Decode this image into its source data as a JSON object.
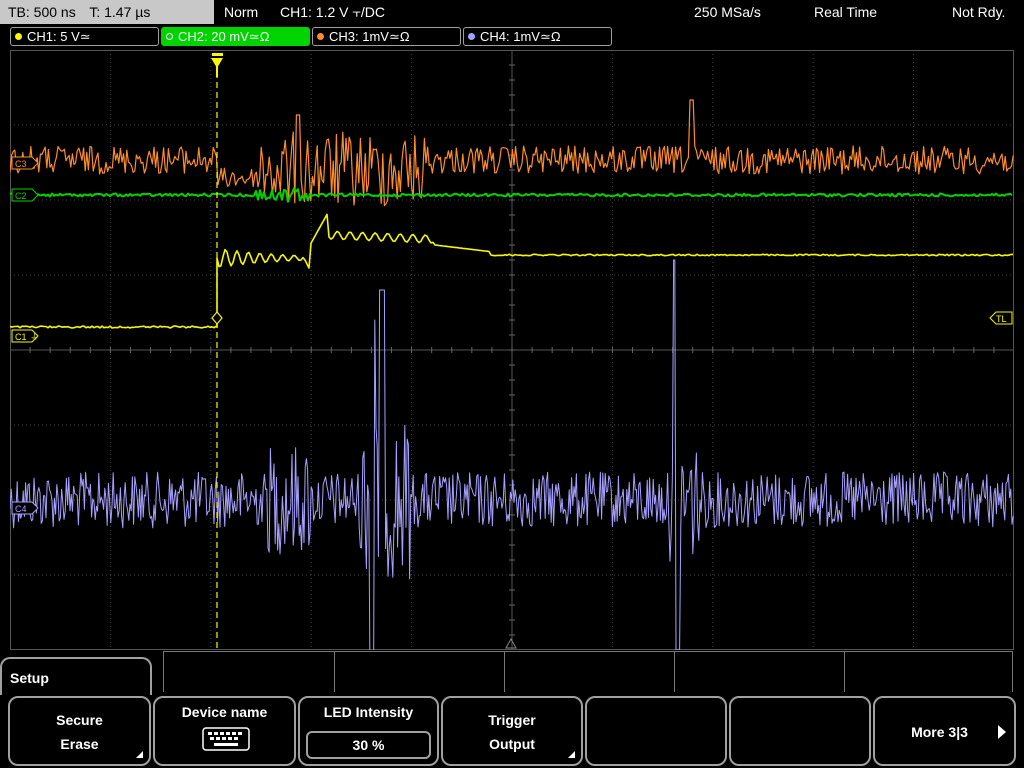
{
  "header": {
    "timebase": "TB: 500 ns",
    "trigger_time": "T: 1.47 µs",
    "mode": "Norm",
    "trigger_info": "CH1: 1.2 V ⫟/DC",
    "sample_rate": "250 MSa/s",
    "acq_mode": "Real Time",
    "state": "Not Rdy."
  },
  "channels": [
    {
      "label": "CH1: 5 V≃",
      "color": "#f8f800",
      "active": false
    },
    {
      "label": "CH2: 20 mV≃Ω",
      "color": "#00d400",
      "active": true
    },
    {
      "label": "CH3: 1mV≃Ω",
      "color": "#ff8c2a",
      "active": false
    },
    {
      "label": "CH4: 1mV≃Ω",
      "color": "#a8a0ff",
      "active": false
    }
  ],
  "markers": {
    "c3": "C3",
    "c2": "C2",
    "c1": "C1",
    "c4": "C4",
    "tl": "TL"
  },
  "menu": {
    "title": "Setup",
    "secure_erase": [
      "Secure",
      "Erase"
    ],
    "device_name": "Device name",
    "led_intensity": "LED Intensity",
    "led_value": "30 %",
    "trigger_output": [
      "Trigger",
      "Output"
    ],
    "more": "More 3|3"
  },
  "colors": {
    "ch1": "#f8f800",
    "ch2": "#00d400",
    "ch3": "#ff8c2a",
    "ch4": "#a8a0ff",
    "grid": "#444444",
    "trigger": "#f8f800"
  }
}
